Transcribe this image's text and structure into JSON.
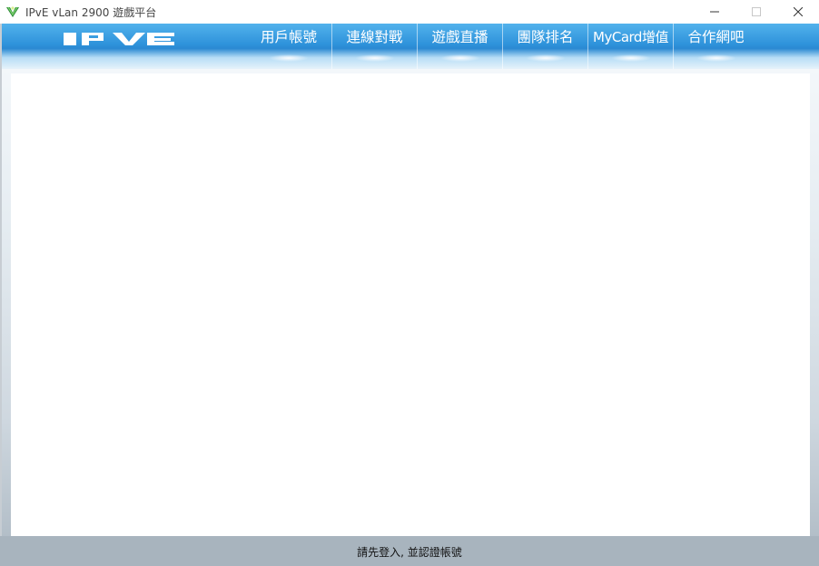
{
  "window": {
    "title": "IPvE vLan 2900 遊戲平台"
  },
  "header": {
    "logo_text": "IPVE",
    "nav": [
      {
        "label": "用戶帳號"
      },
      {
        "label": "連線對戰"
      },
      {
        "label": "遊戲直播"
      },
      {
        "label": "團隊排名"
      },
      {
        "label": "MyCard增值"
      },
      {
        "label": "合作網吧"
      }
    ]
  },
  "status": {
    "message": "請先登入, 並認證帳號"
  },
  "colors": {
    "nav_blue": "#2f93db",
    "status_bar": "#a8b4be"
  }
}
